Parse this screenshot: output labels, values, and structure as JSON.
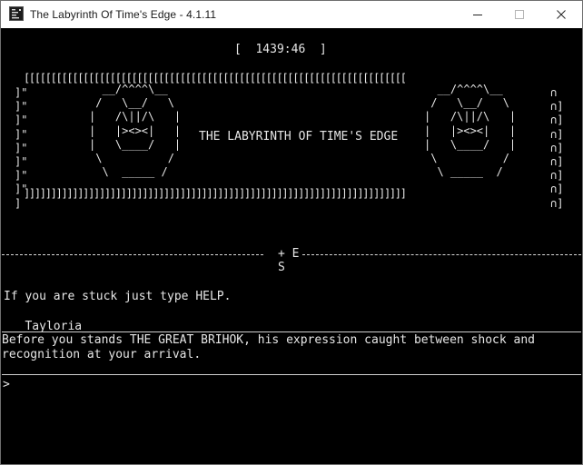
{
  "window": {
    "title": "The Labyrinth Of Time's Edge - 4.1.11",
    "controls": [
      "minimize-icon",
      "maximize-icon",
      "close-icon"
    ]
  },
  "colors": {
    "background": "#000000",
    "text": "#e6e6e6",
    "titlebar": "#ffffff"
  },
  "status": {
    "timer": "[  1439:46  ]"
  },
  "banner": {
    "top_border": "[[[[[[[[[[[[[[[[[[[[[[[[[[[[[[[[[[[[[[[[[[[[[[[[[[[[[[[[[[[[[[[[[[[[[[[",
    "bottom_border": "]]]]]]]]]]]]]]]]]]]]]]]]]]]]]]]]]]]]]]]]]]]]]]]]]]]]]]]]]]]]]]]]]]]]]]]",
    "left_edge": "]\"\n]\"\n]\"\n]\"\n]\"\n]\"\n]\"\n]\"\n]",
    "right_edge": "∩\n∩]\n∩]\n∩]\n∩]\n∩]\n∩]\n∩]\n∩]",
    "face_left": "  __/^^^^\\__\n /   \\__/   \\\n|   /\\||/\\   |\n|   |><><|   |\n|   \\____/   |\n \\          /\n  \\  _____ /",
    "face_right": "  __/^^^^\\__\n /   \\__/   \\\n|   /\\||/\\   |\n|   |><><|   |\n|   \\____/   |\n \\          /\n  \\ _____  /",
    "title": "THE LABYRINTH OF TIME'S EDGE"
  },
  "compass": {
    "top": "+ E",
    "bottom": "S"
  },
  "messages": {
    "help_hint": "If you are stuck just type HELP."
  },
  "room": {
    "name": "___Tayloria___",
    "description": "Before you stands THE GREAT BRIHOK, his expression caught between shock and recognition at your arrival."
  },
  "input": {
    "prompt": ">",
    "value": ""
  }
}
